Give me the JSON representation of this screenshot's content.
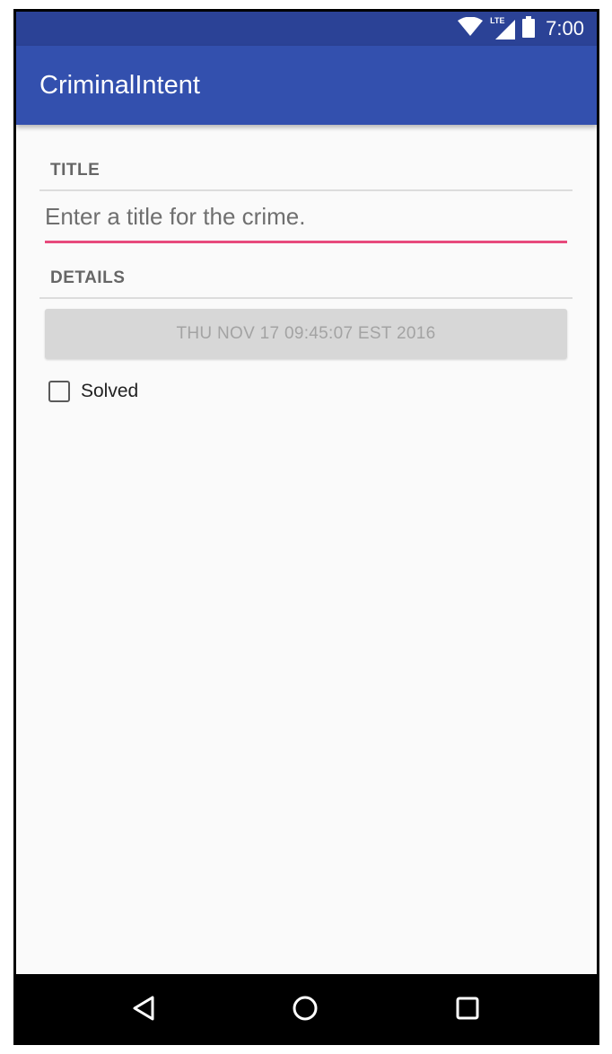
{
  "status_bar": {
    "time": "7:00",
    "network": "LTE",
    "icons": [
      "wifi-icon",
      "cell-signal-icon",
      "battery-icon"
    ]
  },
  "app_bar": {
    "title": "CriminalIntent",
    "color": "#3350ae"
  },
  "title_section": {
    "label": "TITLE",
    "input_placeholder": "Enter a title for the crime.",
    "input_value": ""
  },
  "details_section": {
    "label": "DETAILS",
    "date_button_label": "THU NOV 17 09:45:07 EST 2016",
    "solved_label": "Solved",
    "solved_checked": false
  },
  "nav_bar": {
    "icons": [
      "back-icon",
      "home-icon",
      "recents-icon"
    ]
  },
  "colors": {
    "status_bar": "#2b4296",
    "accent": "#e74a7c",
    "background": "#fafafa"
  }
}
